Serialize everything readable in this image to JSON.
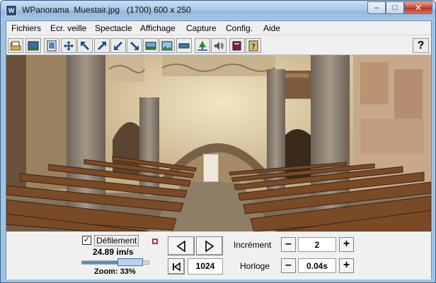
{
  "window": {
    "title": "WPanorama  Muestair.jpg   (1700) 600 x 250",
    "app_icon_glyph": "W",
    "minimize_glyph": "–",
    "maximize_glyph": "□",
    "close_glyph": "✕"
  },
  "menu": {
    "items": [
      {
        "label": "Fichiers"
      },
      {
        "label": "Ecr. veille"
      },
      {
        "label": "Spectacle"
      },
      {
        "label": "Affichage"
      },
      {
        "label": "Capture"
      },
      {
        "label": "Config."
      },
      {
        "label": "Aide"
      }
    ]
  },
  "toolbar": {
    "help_glyph": "?",
    "icons": [
      "open-file-icon",
      "image-icon",
      "fit-page-icon",
      "move-icon",
      "zoom-nw-icon",
      "zoom-ne-icon",
      "zoom-sw-icon",
      "zoom-se-icon",
      "panorama-view-icon",
      "landscape-icon",
      "wide-view-icon",
      "tree-icon",
      "sound-icon",
      "book-icon",
      "help-book-icon"
    ]
  },
  "controls": {
    "scroll_checked": "✓",
    "scroll_label": "Défilement",
    "speed": "24.89 im/s",
    "zoom": "Zoom: 33%",
    "zoom_fraction": 0.33,
    "position": "1024",
    "increment_label": "Incrément",
    "increment_value": "2",
    "clock_label": "Horloge",
    "clock_value": "0.04s",
    "minus": "–",
    "plus": "+"
  },
  "colors": {
    "title_gradient_top": "#c9def3",
    "close_red": "#c8452f",
    "panel_bg": "#f0f0f0",
    "slider_blue": "#4d8fd6"
  }
}
